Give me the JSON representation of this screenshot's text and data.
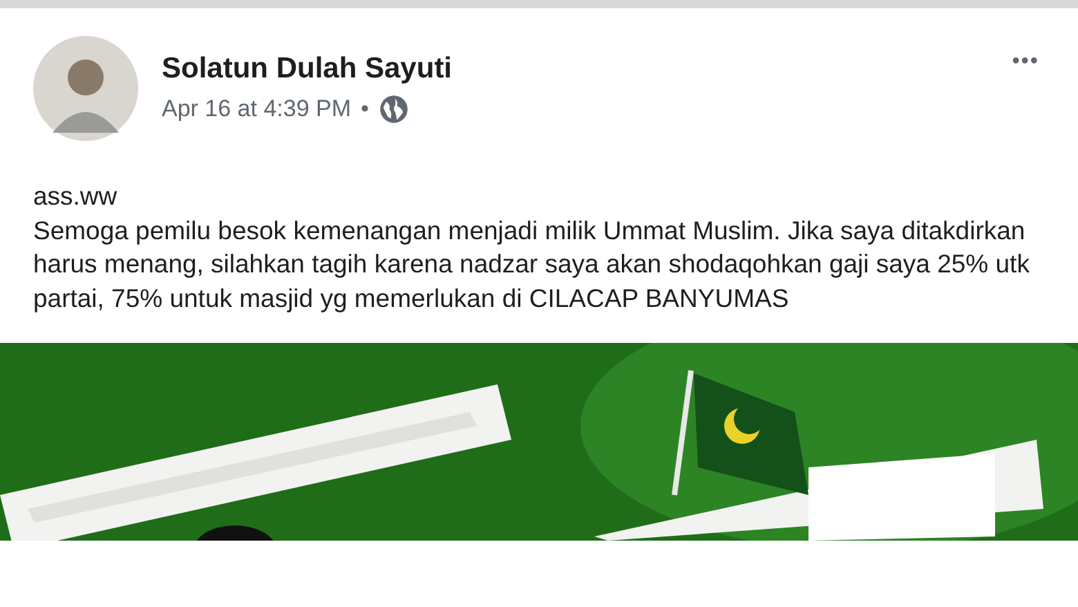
{
  "post": {
    "author": "Solatun Dulah Sayuti",
    "timestamp": "Apr 16 at 4:39 PM",
    "separator": "•",
    "more": "•••",
    "text_lines": [
      "ass.ww",
      "Semoga pemilu besok kemenangan menjadi milik Ummat Muslim. Jika saya ditakdirkan harus menang, silahkan tagih karena nadzar saya akan shodaqohkan gaji saya 25% utk partai, 75% untuk masjid yg memerlukan di CILACAP BANYUMAS"
    ]
  }
}
